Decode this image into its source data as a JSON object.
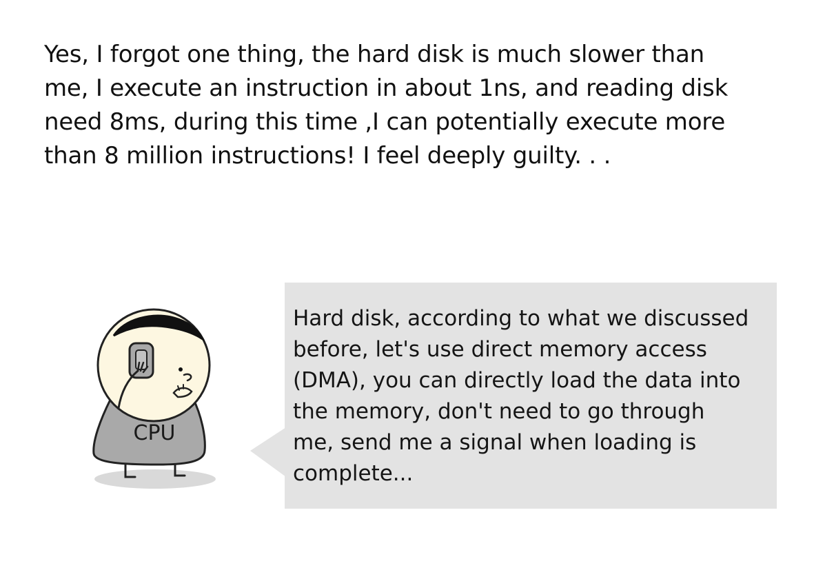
{
  "narration": {
    "lines": [
      "Yes, I forgot one thing, the hard disk is much slower than",
      "me, I execute an instruction in about 1ns, and reading disk",
      "need 8ms, during this time ,I can potentially execute more",
      "than 8 million instructions! I feel deeply guilty. . ."
    ]
  },
  "character": {
    "label": "CPU",
    "body_color": "#a9a9a9",
    "head_color": "#fdf7e1",
    "hair_color": "#111111",
    "shadow_color": "#d9d9d9",
    "icon": "cpu-character-on-phone"
  },
  "speech_bubble": {
    "background": "#e3e3e3",
    "lines": [
      "Hard disk, according to what we discussed",
      "before, let's use direct memory access",
      "(DMA),  you can directly load the data into",
      "the memory, don't need to go through",
      "me, send me a signal when loading is",
      "complete..."
    ]
  }
}
